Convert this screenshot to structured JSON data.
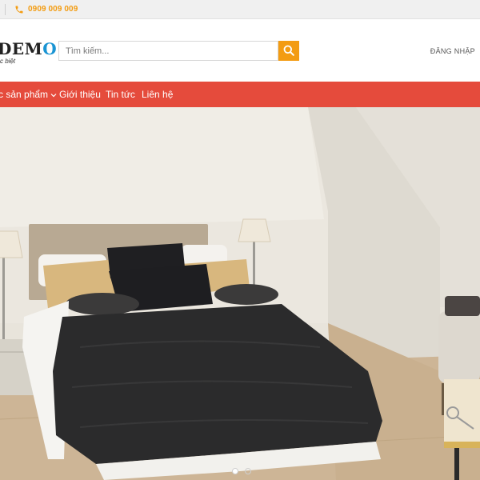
{
  "topbar": {
    "phone": "0909 009 009"
  },
  "header": {
    "logo_main": "DEM",
    "logo_accent": "O",
    "logo_tagline": "c biệt",
    "search_placeholder": "Tìm kiếm...",
    "login_label": "ĐĂNG NHẬP"
  },
  "nav": {
    "items": [
      {
        "label": "c sản phẩm"
      },
      {
        "label": "Giới thiệu"
      },
      {
        "label": "Tin tức"
      },
      {
        "label": "Liên hệ"
      }
    ]
  },
  "colors": {
    "nav_bg": "#e54b3c",
    "accent": "#f39c12",
    "logo_accent": "#1a94d3"
  },
  "slider": {
    "slide_count": 2,
    "active_index": 0
  },
  "icons": [
    "phone-icon",
    "search-icon",
    "chevron-down-icon"
  ]
}
